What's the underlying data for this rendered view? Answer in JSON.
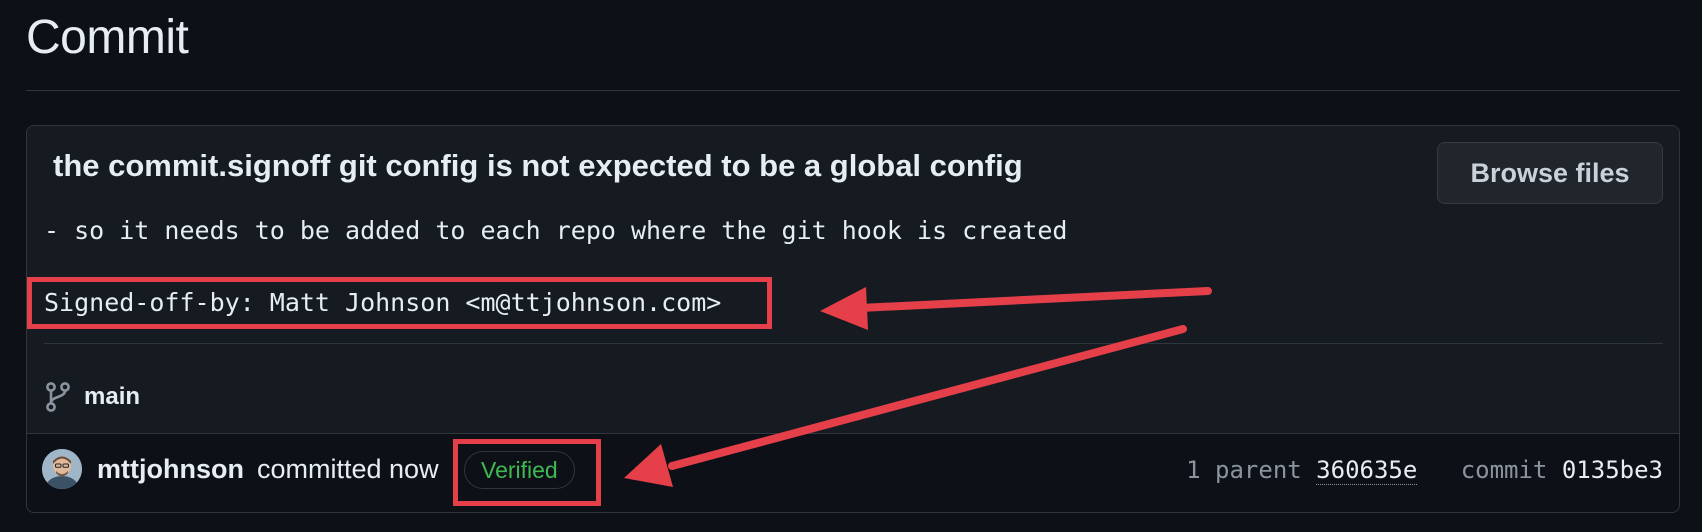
{
  "page": {
    "title": "Commit"
  },
  "commit": {
    "title": "the commit.signoff git config is not expected to be a global config",
    "body": "- so it needs to be added to each repo where the git hook is created",
    "signoff": "Signed-off-by: Matt Johnson <m@ttjohnson.com>",
    "browse_label": "Browse files",
    "branch": "main",
    "author": "mttjohnson",
    "committed_text": "committed now",
    "verified_label": "Verified",
    "parent_label": "1 parent",
    "parent_sha": "360635e",
    "commit_label": "commit",
    "commit_sha": "0135be3"
  },
  "annotations": {
    "color": "#e5404a"
  }
}
